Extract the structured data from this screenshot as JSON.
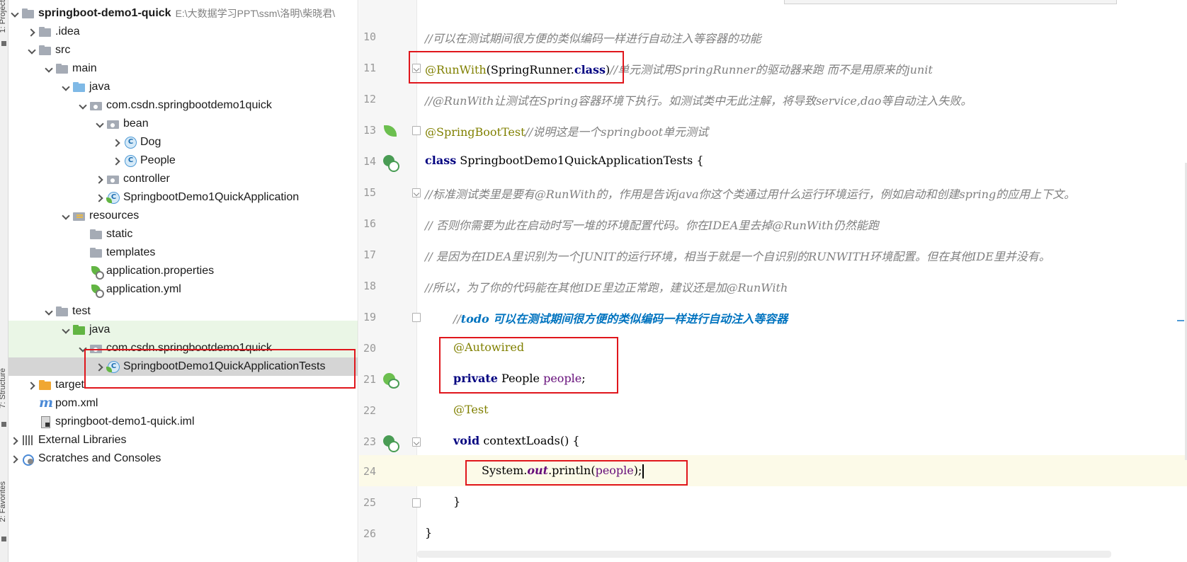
{
  "tool_strip": {
    "project_label": "1: Project",
    "structure_label": "7: Structure",
    "favorites_label": "2: Favorites"
  },
  "project_tree": {
    "root": {
      "label": "springboot-demo1-quick",
      "path": "E:\\大数据学习PPT\\ssm\\洛明\\柴晓君\\"
    },
    "rows": [
      {
        "label": ".idea",
        "icon": "folder-icon"
      },
      {
        "label": "src",
        "icon": "folder-icon"
      },
      {
        "label": "main",
        "icon": "folder-icon"
      },
      {
        "label": "java",
        "icon": "source-folder-icon"
      },
      {
        "label": "com.csdn.springbootdemo1quick",
        "icon": "package-icon"
      },
      {
        "label": "bean",
        "icon": "package-icon"
      },
      {
        "label": "Dog",
        "icon": "class-icon"
      },
      {
        "label": "People",
        "icon": "class-icon"
      },
      {
        "label": "controller",
        "icon": "package-icon"
      },
      {
        "label": "SpringbootDemo1QuickApplication",
        "icon": "spring-class-icon"
      },
      {
        "label": "resources",
        "icon": "resources-folder-icon"
      },
      {
        "label": "static",
        "icon": "folder-icon"
      },
      {
        "label": "templates",
        "icon": "folder-icon"
      },
      {
        "label": "application.properties",
        "icon": "spring-properties-icon"
      },
      {
        "label": "application.yml",
        "icon": "spring-properties-icon"
      },
      {
        "label": "test",
        "icon": "folder-icon"
      },
      {
        "label": "java",
        "icon": "test-source-folder-icon"
      },
      {
        "label": "com.csdn.springbootdemo1quick",
        "icon": "package-icon"
      },
      {
        "label": "SpringbootDemo1QuickApplicationTests",
        "icon": "spring-class-icon"
      },
      {
        "label": "target",
        "icon": "excluded-folder-icon"
      },
      {
        "label": "pom.xml",
        "icon": "maven-icon"
      },
      {
        "label": "springboot-demo1-quick.iml",
        "icon": "iml-file-icon"
      },
      {
        "label": "External Libraries",
        "icon": "libraries-icon"
      },
      {
        "label": "Scratches and Consoles",
        "icon": "scratches-icon"
      }
    ]
  },
  "editor": {
    "line_numbers": [
      "10",
      "11",
      "12",
      "13",
      "14",
      "15",
      "16",
      "17",
      "18",
      "19",
      "20",
      "21",
      "22",
      "23",
      "24",
      "25",
      "26"
    ],
    "l10": {
      "comment": "//可以在测试期间很方便的类似编码一样进行自动注入等容器的功能"
    },
    "l11": {
      "annotation": "@RunWith",
      "paren_open": "(SpringRunner.",
      "keyword": "class",
      "paren_close": ")",
      "comment": "//单元测试用SpringRunner的驱动器来跑 而不是用原来的junit"
    },
    "l12": {
      "comment": "//@RunWith让测试在Spring容器环境下执行。如测试类中无此注解，将导致service,dao等自动注入失败。"
    },
    "l13": {
      "annotation": "@SpringBootTest",
      "comment": "//说明这是一个springboot单元测试"
    },
    "l14": {
      "keyword": "class",
      "rest": " SpringbootDemo1QuickApplicationTests {"
    },
    "l15": {
      "comment": "//标准测试类里是要有@RunWith的，作用是告诉java你这个类通过用什么运行环境运行，例如启动和创建spring的应用上下文。"
    },
    "l16": {
      "comment": "// 否则你需要为此在启动时写一堆的环境配置代码。你在IDEA里去掉@RunWith仍然能跑"
    },
    "l17": {
      "comment": "// 是因为在IDEA里识别为一个JUNIT的运行环境，相当于就是一个自识别的RUNWITH环境配置。但在其他IDE里并没有。"
    },
    "l18": {
      "comment": "//所以，为了你的代码能在其他IDE里边正常跑，建议还是加@RunWith"
    },
    "l19": {
      "comment_prefix": "//",
      "todo": "todo 可以在测试期间很方便的类似编码一样进行自动注入等容器"
    },
    "l20": {
      "annotation": "@Autowired"
    },
    "l21": {
      "keyword": "private",
      "type": " People ",
      "field": "people",
      "end": ";"
    },
    "l22": {
      "annotation": "@Test"
    },
    "l23": {
      "keyword": "void",
      "rest": " contextLoads() {"
    },
    "l24": {
      "system": "System.",
      "static_field": "out",
      "call": ".println(",
      "field": "people",
      "end": ");"
    },
    "l25": {
      "text": "}"
    },
    "l26": {
      "text": "}"
    }
  },
  "colors": {
    "highlight_box": "#e0161c",
    "comment": "#808080",
    "annotation": "#808000",
    "keyword": "#000080",
    "field": "#660e7a",
    "todo": "#0073bf"
  }
}
